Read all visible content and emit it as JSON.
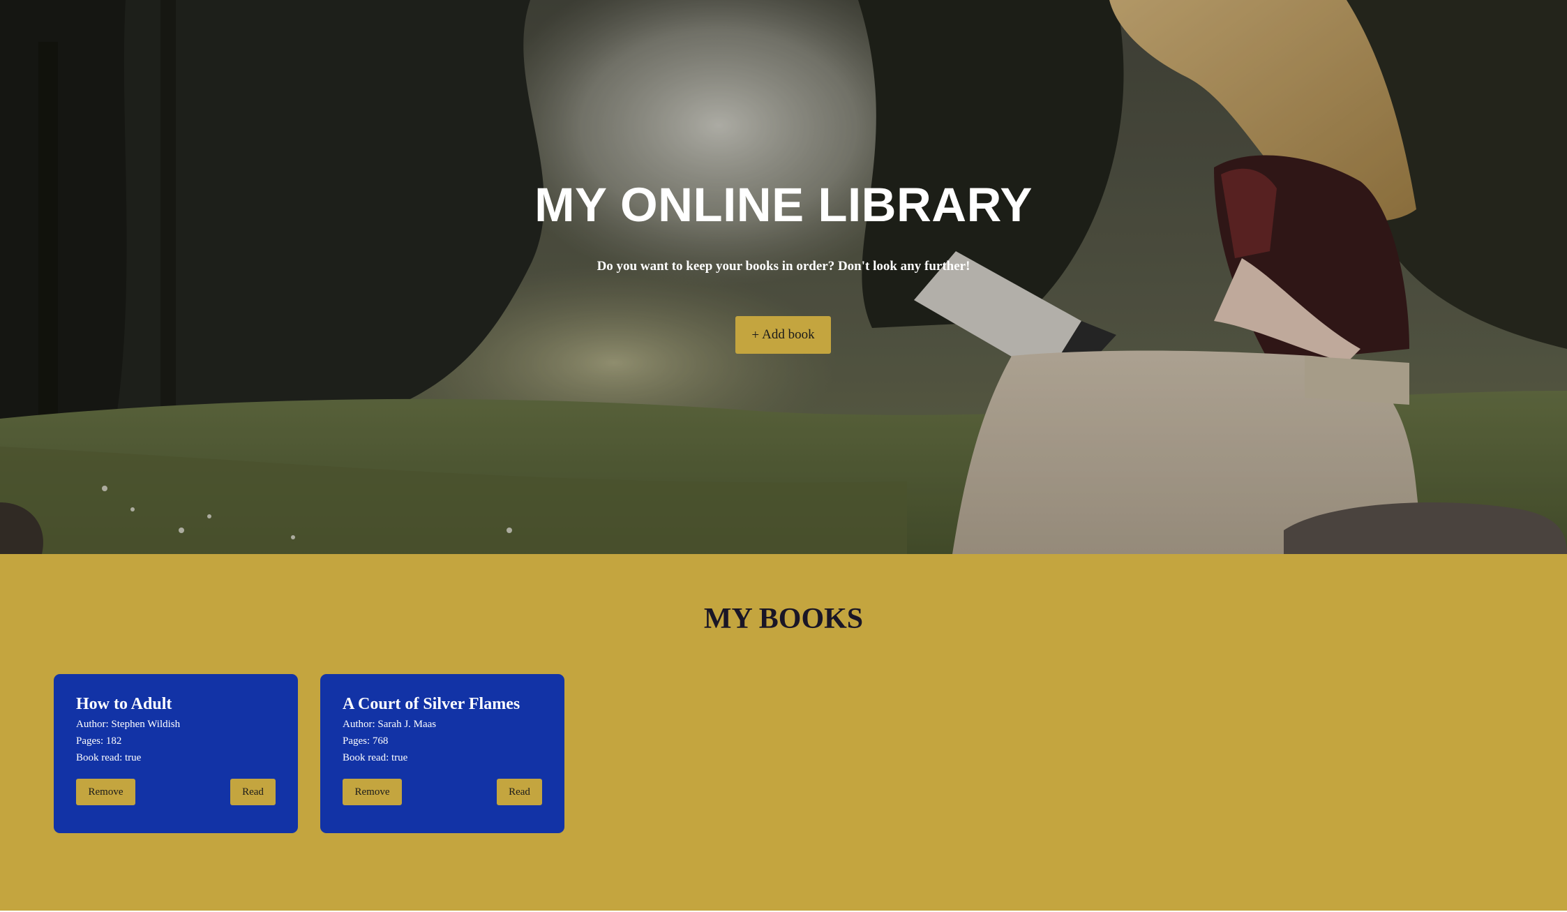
{
  "hero": {
    "title": "MY ONLINE LIBRARY",
    "subtitle": "Do you want to keep your books in order? Don't look any further!",
    "add_button": {
      "icon": "plus-icon",
      "icon_glyph": "+",
      "label": "Add book"
    }
  },
  "books_section": {
    "heading": "MY BOOKS",
    "books": [
      {
        "title": "How to Adult",
        "author": "Author: Stephen Wildish",
        "pages": "Pages: 182",
        "read_status": "Book read: true",
        "remove_label": "Remove",
        "read_label": "Read"
      },
      {
        "title": "A Court of Silver Flames",
        "author": "Author: Sarah J. Maas",
        "pages": "Pages: 768",
        "read_status": "Book read: true",
        "remove_label": "Remove",
        "read_label": "Read"
      }
    ]
  },
  "colors": {
    "accent": "#c4a53f",
    "card_background": "#1233a6",
    "heading_dark": "#1a1626"
  }
}
